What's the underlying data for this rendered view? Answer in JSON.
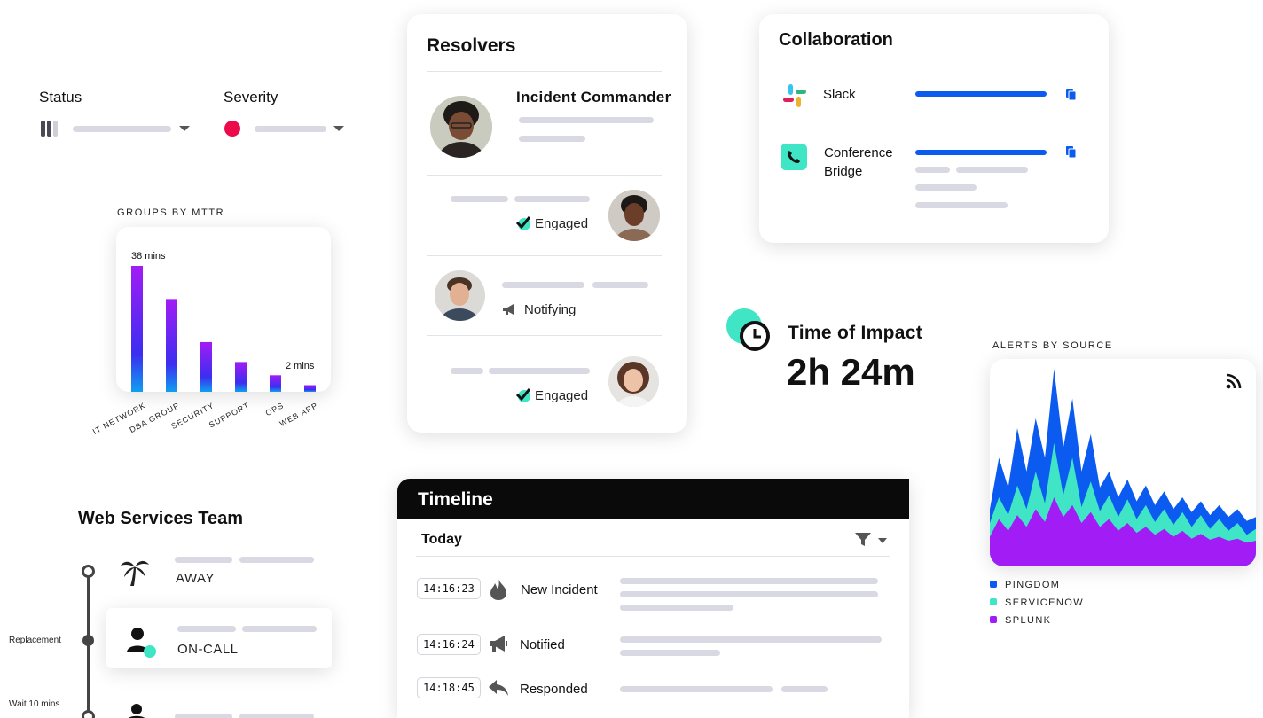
{
  "filters": {
    "status_label": "Status",
    "severity_label": "Severity"
  },
  "mttr": {
    "title": "GROUPS BY MTTR",
    "top_label": "38 mins",
    "bottom_label": "2 mins"
  },
  "chart_data": [
    {
      "type": "bar",
      "title": "GROUPS BY MTTR",
      "categories": [
        "IT NETWORK",
        "DBA GROUP",
        "SECURITY",
        "SUPPORT",
        "OPS",
        "WEB APP"
      ],
      "values": [
        38,
        28,
        15,
        9,
        5,
        2
      ],
      "ylim": [
        0,
        40
      ],
      "annotations": [
        "38 mins",
        "2 mins"
      ],
      "colors": [
        "#a21cf5",
        "#0f8ff0"
      ]
    },
    {
      "type": "area",
      "title": "ALERTS BY SOURCE",
      "x": [
        1,
        2,
        3,
        4,
        5,
        6,
        7,
        8,
        9,
        10,
        11,
        12,
        13,
        14,
        15,
        16,
        17,
        18,
        19,
        20,
        21,
        22,
        23,
        24,
        25,
        26,
        27,
        28,
        29,
        30
      ],
      "series": [
        {
          "name": "SPLUNK",
          "values": [
            30,
            48,
            36,
            52,
            40,
            58,
            45,
            70,
            50,
            62,
            44,
            55,
            40,
            48,
            36,
            44,
            34,
            40,
            32,
            38,
            30,
            36,
            28,
            33,
            27,
            30,
            26,
            28,
            24,
            26
          ]
        },
        {
          "name": "SERVICENOW",
          "values": [
            44,
            70,
            52,
            82,
            58,
            96,
            64,
            125,
            72,
            110,
            60,
            86,
            56,
            72,
            50,
            68,
            48,
            62,
            45,
            58,
            42,
            55,
            40,
            52,
            38,
            48,
            36,
            44,
            32,
            38
          ]
        },
        {
          "name": "PINGDOM",
          "values": [
            58,
            110,
            80,
            140,
            96,
            150,
            110,
            200,
            120,
            170,
            96,
            134,
            80,
            96,
            70,
            88,
            66,
            82,
            62,
            76,
            58,
            70,
            55,
            66,
            52,
            62,
            50,
            58,
            46,
            50
          ]
        }
      ],
      "legend": "bottom-left"
    }
  ],
  "alerts": {
    "title": "ALERTS BY SOURCE",
    "legend": [
      {
        "name": "PINGDOM",
        "color": "#0b5bf0"
      },
      {
        "name": "SERVICENOW",
        "color": "#3fe5c5"
      },
      {
        "name": "SPLUNK",
        "color": "#a21cf5"
      }
    ]
  },
  "resolvers": {
    "title": "Resolvers",
    "commander_title": "Incident Commander",
    "rows": [
      {
        "status": "Engaged"
      },
      {
        "status": "Notifying"
      },
      {
        "status": "Engaged"
      }
    ]
  },
  "collaboration": {
    "title": "Collaboration",
    "slack": "Slack",
    "bridge_line1": "Conference",
    "bridge_line2": "Bridge"
  },
  "impact": {
    "label": "Time of Impact",
    "value": "2h 24m"
  },
  "team": {
    "title": "Web Services Team",
    "away": "AWAY",
    "oncall": "ON-CALL",
    "replacement": "Replacement",
    "wait": "Wait 10 mins"
  },
  "timeline": {
    "title": "Timeline",
    "day": "Today",
    "events": [
      {
        "time": "14:16:23",
        "label": "New Incident"
      },
      {
        "time": "14:16:24",
        "label": "Notified"
      },
      {
        "time": "14:18:45",
        "label": "Responded"
      }
    ]
  }
}
